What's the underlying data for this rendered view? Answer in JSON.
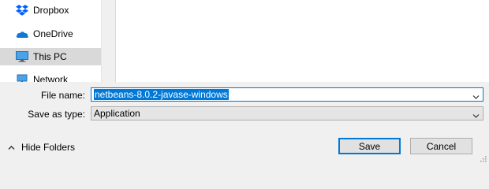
{
  "nav": {
    "items": [
      {
        "label": "Dropbox",
        "icon": "dropbox-icon"
      },
      {
        "label": "OneDrive",
        "icon": "onedrive-icon"
      },
      {
        "label": "This PC",
        "icon": "this-pc-icon",
        "selected": true
      },
      {
        "label": "Network",
        "icon": "network-icon"
      }
    ]
  },
  "form": {
    "file_name_label": "File name:",
    "file_name_value": "netbeans-8.0.2-javase-windows",
    "save_as_type_label": "Save as type:",
    "save_as_type_value": "Application"
  },
  "footer": {
    "hide_folders_label": "Hide Folders",
    "save_label": "Save",
    "cancel_label": "Cancel"
  },
  "colors": {
    "accent": "#0078d7",
    "dropbox": "#0061fe",
    "onedrive": "#0f78d4"
  }
}
